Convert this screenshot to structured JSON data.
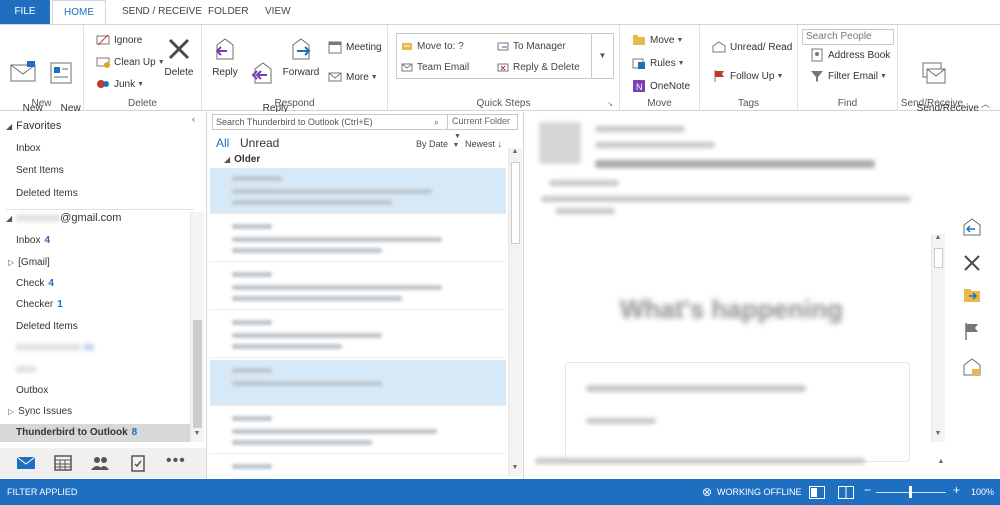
{
  "tabs": [
    {
      "label": "FILE"
    },
    {
      "label": "HOME"
    },
    {
      "label": "SEND / RECEIVE"
    },
    {
      "label": "FOLDER"
    },
    {
      "label": "VIEW"
    }
  ],
  "ribbon": {
    "new_group": {
      "label": "New",
      "new_email": "New\nEmail",
      "new_items": "New\nItems"
    },
    "delete_group": {
      "label": "Delete",
      "ignore": "Ignore",
      "cleanup": "Clean Up",
      "junk": "Junk",
      "delete": "Delete"
    },
    "respond_group": {
      "label": "Respond",
      "reply": "Reply",
      "reply_all": "Reply\nAll",
      "forward": "Forward",
      "meeting": "Meeting",
      "more": "More"
    },
    "quicksteps_group": {
      "label": "Quick Steps",
      "move_to": "Move to: ?",
      "to_manager": "To Manager",
      "team_email": "Team Email",
      "reply_delete": "Reply & Delete"
    },
    "move_group": {
      "label": "Move",
      "move": "Move",
      "rules": "Rules",
      "onenote": "OneNote"
    },
    "tags_group": {
      "label": "Tags",
      "unread_read": "Unread/ Read",
      "follow_up": "Follow Up"
    },
    "find_group": {
      "label": "Find",
      "search_people_placeholder": "Search People",
      "address_book": "Address Book",
      "filter_email": "Filter Email"
    },
    "sendreceive_group": {
      "label": "Send/Receive",
      "send_receive_all": "Send/Receive\nAll Folders"
    }
  },
  "folders": {
    "favorites_label": "Favorites",
    "favorites": [
      {
        "label": "Inbox"
      },
      {
        "label": "Sent Items"
      },
      {
        "label": "Deleted Items"
      }
    ],
    "account_label": "@gmail.com",
    "account_items": [
      {
        "label": "Inbox",
        "count": "4"
      },
      {
        "label": "[Gmail]",
        "count": ""
      },
      {
        "label": "Check",
        "count": "4"
      },
      {
        "label": "Checker",
        "count": "1"
      },
      {
        "label": "Deleted Items",
        "count": ""
      },
      {
        "label": "Outbox",
        "count": ""
      },
      {
        "label": "Sync Issues",
        "count": ""
      },
      {
        "label": "Thunderbird to Outlook",
        "count": "8"
      }
    ]
  },
  "message_list": {
    "search_placeholder": "Search Thunderbird to Outlook (Ctrl+E)",
    "scope": "Current Folder",
    "filter_all": "All",
    "filter_unread": "Unread",
    "sort_by": "By Date",
    "sort_order": "Newest",
    "group_header": "Older"
  },
  "status": {
    "filter_applied": "FILTER APPLIED",
    "working_offline": "WORKING OFFLINE",
    "zoom": "100%"
  },
  "reading_pane": {
    "headline": "What's happening"
  },
  "colors": {
    "accent": "#1e6fc0",
    "selected_row": "#d7e9f7"
  }
}
